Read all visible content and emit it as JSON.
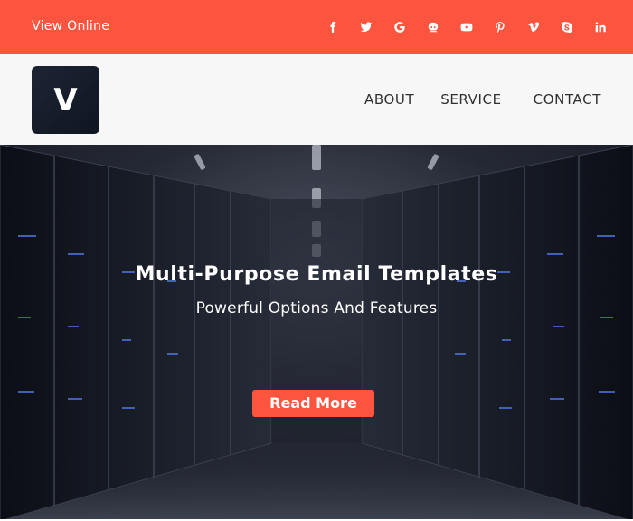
{
  "topbar": {
    "view_online": "View Online",
    "background": "#fb543f",
    "socials": [
      {
        "name": "facebook-icon"
      },
      {
        "name": "twitter-icon"
      },
      {
        "name": "google-icon"
      },
      {
        "name": "github-icon"
      },
      {
        "name": "youtube-icon"
      },
      {
        "name": "pinterest-icon"
      },
      {
        "name": "vimeo-icon"
      },
      {
        "name": "skype-icon"
      },
      {
        "name": "linkedin-icon"
      }
    ]
  },
  "header": {
    "logo_letter": "V",
    "nav": {
      "about": "ABOUT",
      "service": "SERVICE",
      "contact": "CONTACT"
    }
  },
  "hero": {
    "title": "Multi-Purpose Email Templates",
    "subtitle": "Powerful Options And Features",
    "button": "Read More",
    "accent": "#fb543f"
  }
}
